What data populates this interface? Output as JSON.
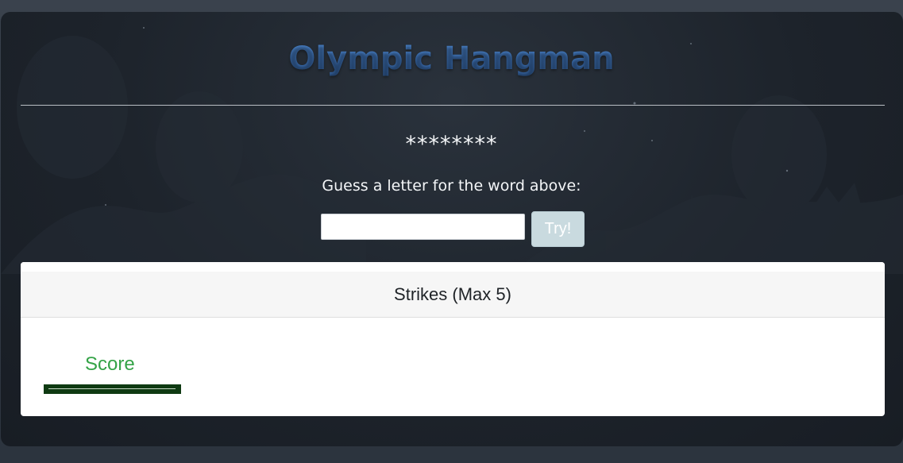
{
  "app": {
    "title": "Olympic Hangman"
  },
  "game": {
    "masked_word": "********",
    "prompt": "Guess a letter for the word above:",
    "input_value": "",
    "input_placeholder": "",
    "try_label": "Try!"
  },
  "strikes": {
    "header": "Strikes (Max 5)"
  },
  "score": {
    "label": "Score"
  },
  "colors": {
    "title": "#3f73b5",
    "score": "#34a347",
    "score_bar": "#0f3a12",
    "try_button": "#c9dadf",
    "panel_background": "#1d232b"
  }
}
